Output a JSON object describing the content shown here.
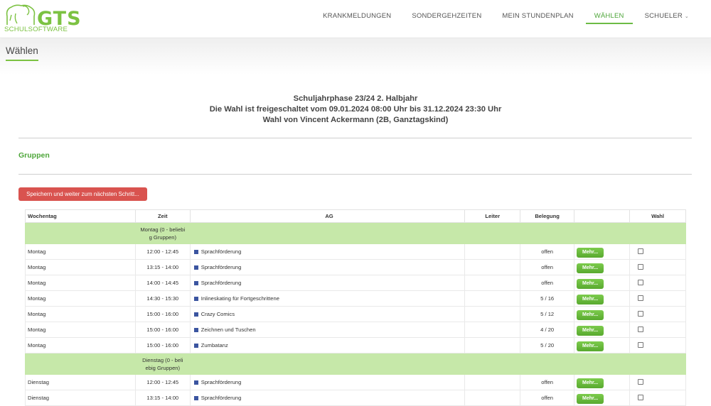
{
  "logo": {
    "title": "GTS",
    "subtitle": "SCHULSOFTWARE"
  },
  "nav": [
    {
      "label": "KRANKMELDUNGEN"
    },
    {
      "label": "SONDERGEHZEITEN"
    },
    {
      "label": "MEIN STUNDENPLAN"
    },
    {
      "label": "WÄHLEN"
    },
    {
      "label": "SCHUELER"
    }
  ],
  "page": {
    "title": "Wählen"
  },
  "header": {
    "line1": "Schuljahrphase 23/24 2. Halbjahr",
    "line2": "Die Wahl ist freigeschaltet vom 09.01.2024 08:00 Uhr bis 31.12.2024 23:30 Uhr",
    "line3": "Wahl von Vincent Ackermann (2B, Ganztagskind)"
  },
  "section": {
    "title": "Gruppen"
  },
  "actions": {
    "save_label": "Speichern und weiter zum nächsten Schritt..."
  },
  "colors": {
    "accent": "#7cc242",
    "group_row": "#c6e8a9",
    "danger": "#d9534f",
    "ag_marker": "#3b55a0"
  },
  "table": {
    "headers": {
      "wochentag": "Wochentag",
      "zeit": "Zeit",
      "ag": "AG",
      "leiter": "Leiter",
      "belegung": "Belegung",
      "mehr": "",
      "wahl": "Wahl"
    },
    "mehr_label": "Mehr...",
    "groups": {
      "montag": {
        "line1": "Montag (0 - beliebi",
        "line2": "g Gruppen)"
      },
      "dienstag": {
        "line1": "Dienstag   (0 - beli",
        "line2": "ebig Gruppen)"
      }
    },
    "rows": [
      {
        "day": "Montag",
        "time": "12:00 - 12:45",
        "ag": "Sprachförderung",
        "leiter": "",
        "belegung": "offen"
      },
      {
        "day": "Montag",
        "time": "13:15 - 14:00",
        "ag": "Sprachförderung",
        "leiter": "",
        "belegung": "offen"
      },
      {
        "day": "Montag",
        "time": "14:00 - 14:45",
        "ag": "Sprachförderung",
        "leiter": "",
        "belegung": "offen"
      },
      {
        "day": "Montag",
        "time": "14:30 - 15:30",
        "ag": "Inlineskating für Fortgeschrittene",
        "leiter": "",
        "belegung": "5 / 16"
      },
      {
        "day": "Montag",
        "time": "15:00 - 16:00",
        "ag": "Crazy Comics",
        "leiter": "",
        "belegung": "5 / 12"
      },
      {
        "day": "Montag",
        "time": "15:00 - 16:00",
        "ag": "Zeichnen und Tuschen",
        "leiter": "",
        "belegung": "4 / 20"
      },
      {
        "day": "Montag",
        "time": "15:00 - 16:00",
        "ag": "Zumbatanz",
        "leiter": "",
        "belegung": "5 / 20"
      },
      {
        "day": "Dienstag",
        "time": "12:00 - 12:45",
        "ag": "Sprachförderung",
        "leiter": "",
        "belegung": "offen"
      },
      {
        "day": "Dienstag",
        "time": "13:15 - 14:00",
        "ag": "Sprachförderung",
        "leiter": "",
        "belegung": "offen"
      }
    ]
  }
}
